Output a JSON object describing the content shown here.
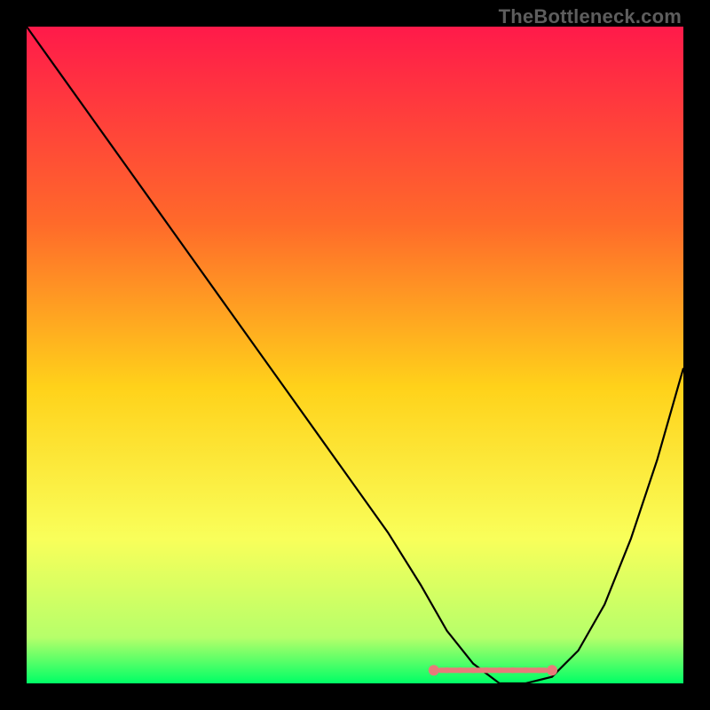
{
  "watermark": "TheBottleneck.com",
  "colors": {
    "gradient_top": "#ff1a4a",
    "gradient_mid1": "#ff6a2a",
    "gradient_mid2": "#ffd21a",
    "gradient_mid3": "#f9ff5a",
    "gradient_bottom_upper": "#b6ff6a",
    "gradient_bottom": "#00ff66",
    "curve": "#000000",
    "highlight": "#e77b7a",
    "background": "#000000"
  },
  "chart_data": {
    "type": "line",
    "title": "",
    "xlabel": "",
    "ylabel": "",
    "xlim": [
      0,
      100
    ],
    "ylim": [
      0,
      100
    ],
    "grid": false,
    "legend": false,
    "series": [
      {
        "name": "bottleneck-curve",
        "x": [
          0,
          5,
          10,
          15,
          20,
          25,
          30,
          35,
          40,
          45,
          50,
          55,
          60,
          64,
          68,
          72,
          76,
          80,
          84,
          88,
          92,
          96,
          100
        ],
        "values": [
          100,
          93,
          86,
          79,
          72,
          65,
          58,
          51,
          44,
          37,
          30,
          23,
          15,
          8,
          3,
          0,
          0,
          1,
          5,
          12,
          22,
          34,
          48
        ]
      }
    ],
    "annotations": [
      {
        "name": "optimal-range-highlight",
        "x_start": 62,
        "x_end": 80,
        "y": 2
      }
    ]
  }
}
